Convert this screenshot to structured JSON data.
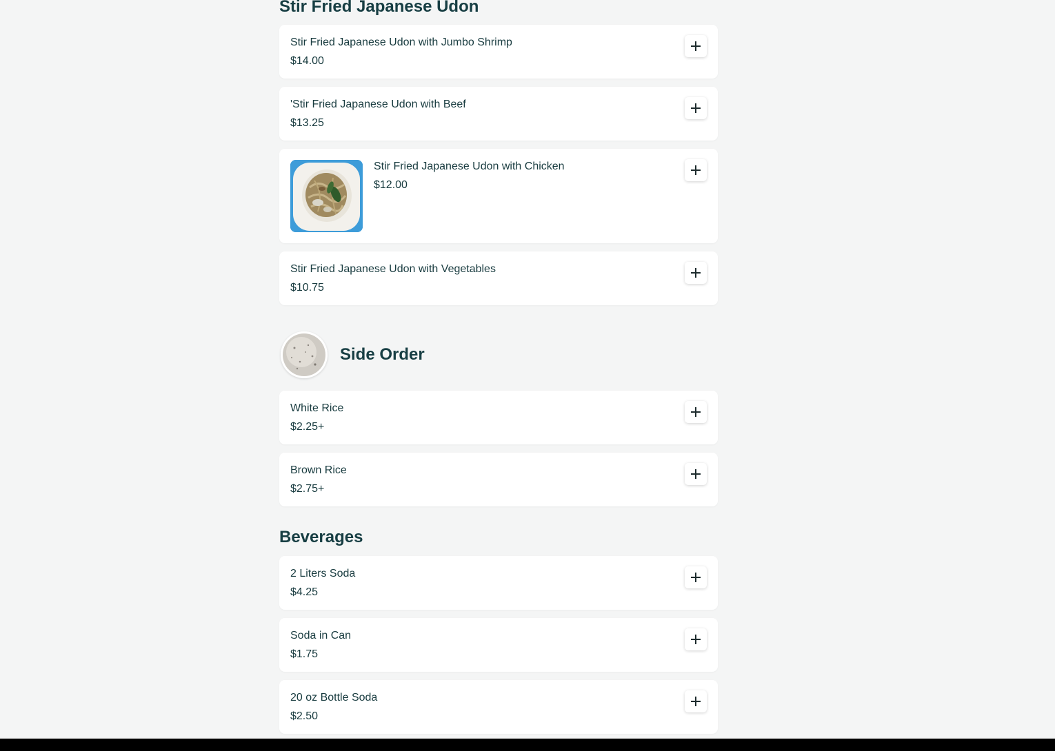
{
  "sections": {
    "udon": {
      "title": "Stir Fried Japanese Udon",
      "items": [
        {
          "name": "Stir Fried Japanese Udon with Jumbo Shrimp",
          "price": "$14.00"
        },
        {
          "name": "'Stir Fried Japanese Udon with Beef",
          "price": "$13.25"
        },
        {
          "name": "Stir Fried Japanese Udon with Chicken",
          "price": "$12.00",
          "image": "stir-fried-udon-chicken-photo"
        },
        {
          "name": "Stir Fried Japanese Udon with Vegetables",
          "price": "$10.75"
        }
      ]
    },
    "side": {
      "title": "Side Order",
      "image": "white-rice-photo",
      "items": [
        {
          "name": "White Rice",
          "price": "$2.25+"
        },
        {
          "name": "Brown Rice",
          "price": "$2.75+"
        }
      ]
    },
    "beverages": {
      "title": "Beverages",
      "items": [
        {
          "name": "2 Liters Soda",
          "price": "$4.25"
        },
        {
          "name": "Soda in Can",
          "price": "$1.75"
        },
        {
          "name": "20 oz Bottle Soda",
          "price": "$2.50"
        }
      ]
    }
  },
  "icons": {
    "add": "plus-icon"
  },
  "colors": {
    "background": "#f4f5f5",
    "card": "#ffffff",
    "text": "#183b3f",
    "thumb_background": "#3d9cd9"
  }
}
